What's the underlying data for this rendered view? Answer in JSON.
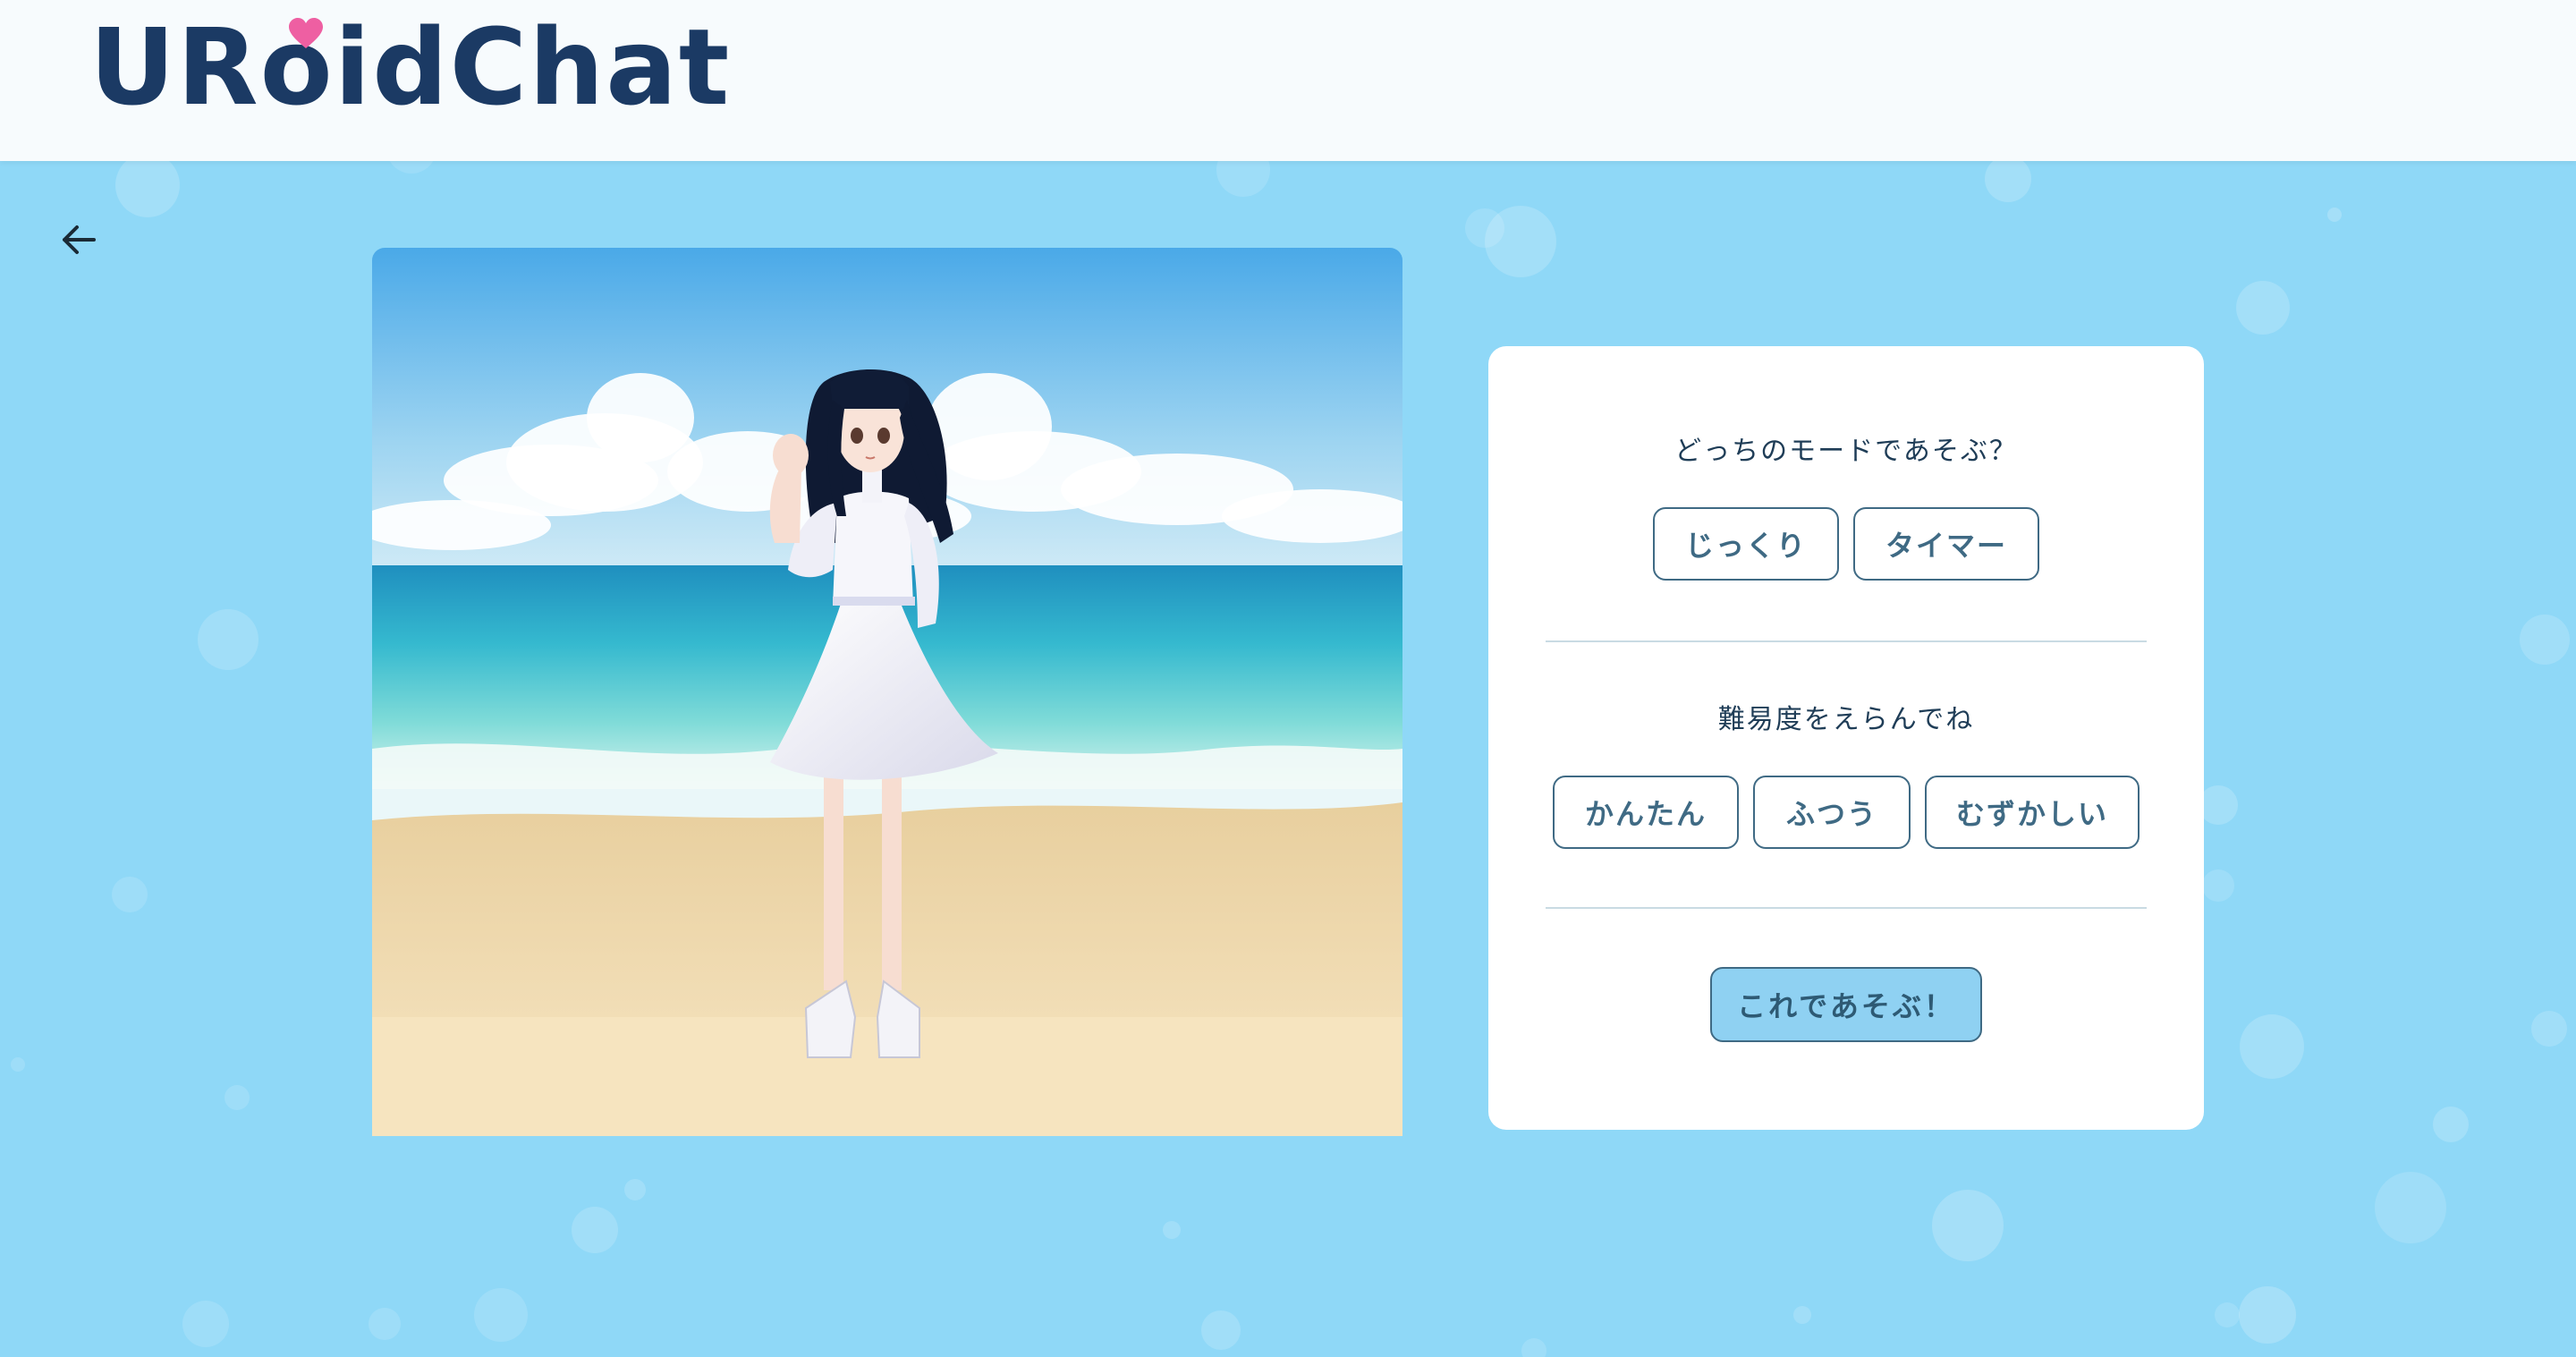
{
  "app": {
    "logo_text": "URoidChat"
  },
  "colors": {
    "background": "#8fd8f7",
    "header": "#f7fbfd",
    "logo": "#1b3a64",
    "heart": "#ee5fa2",
    "button_border": "#3f6a84",
    "play_button_fill": "#8fd1f2"
  },
  "icons": {
    "back": "arrow-left-icon",
    "heart": "heart-icon"
  },
  "scene": {
    "description_icon": "character-on-beach-image"
  },
  "mode_section": {
    "question": "どっちのモードであそぶ？",
    "options": [
      "じっくり",
      "タイマー"
    ]
  },
  "difficulty_section": {
    "question": "難易度をえらんでね",
    "options": [
      "かんたん",
      "ふつう",
      "むずかしい"
    ]
  },
  "play_button_label": "これであそぶ！"
}
